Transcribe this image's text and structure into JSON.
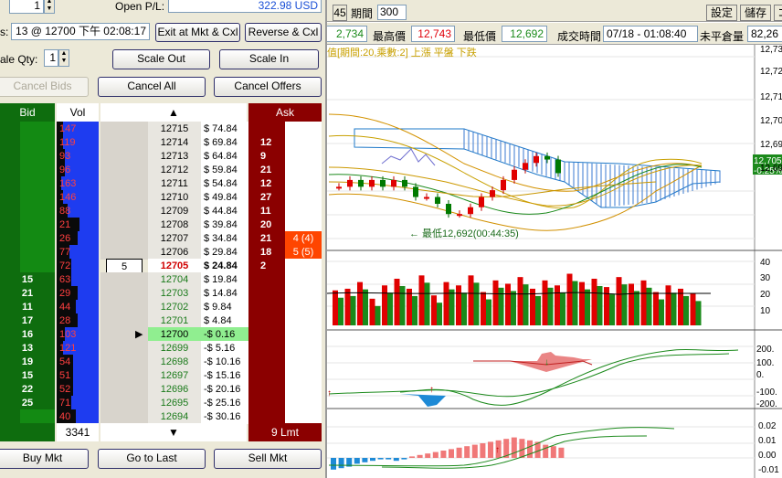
{
  "order_entry": {
    "qty_value": "1",
    "open_pnl_label": "Open P/L:",
    "open_pnl_value": "322.98 USD",
    "position_label_partial": "s:",
    "position_value": "13 @ 12700 下午 02:08:17",
    "exit_button": "Exit at Mkt & Cxl",
    "reverse_button": "Reverse & Cxl",
    "scale_qty_label": "ale Qty:",
    "scale_qty_value": "1",
    "scale_out_button": "Scale Out",
    "scale_in_button": "Scale In",
    "cancel_bids_button": "Cancel Bids",
    "cancel_all_button": "Cancel All",
    "cancel_offers_button": "Cancel Offers"
  },
  "ladder_headers": {
    "bid": "Bid",
    "vol": "Vol",
    "up_arrow": "▲",
    "ask": "Ask"
  },
  "ladder_rows": [
    {
      "bid": "",
      "vol": "147",
      "vol_frac": 0.15,
      "sel": "",
      "price": "12715",
      "pnl": "$ 74.84",
      "ask": "",
      "ord": ""
    },
    {
      "bid": "",
      "vol": "119",
      "vol_frac": 0.15,
      "sel": "",
      "price": "12714",
      "pnl": "$ 69.84",
      "ask": "12",
      "ord": ""
    },
    {
      "bid": "",
      "vol": "93",
      "vol_frac": 0.2,
      "sel": "",
      "price": "12713",
      "pnl": "$ 64.84",
      "ask": "9",
      "ord": ""
    },
    {
      "bid": "",
      "vol": "96",
      "vol_frac": 0.2,
      "sel": "",
      "price": "12712",
      "pnl": "$ 59.84",
      "ask": "21",
      "ord": ""
    },
    {
      "bid": "",
      "vol": "163",
      "vol_frac": 0.1,
      "sel": "",
      "price": "12711",
      "pnl": "$ 54.84",
      "ask": "12",
      "ord": ""
    },
    {
      "bid": "",
      "vol": "146",
      "vol_frac": 0.15,
      "sel": "",
      "price": "12710",
      "pnl": "$ 49.84",
      "ask": "27",
      "ord": ""
    },
    {
      "bid": "",
      "vol": "88",
      "vol_frac": 0.25,
      "sel": "",
      "price": "12709",
      "pnl": "$ 44.84",
      "ask": "11",
      "ord": ""
    },
    {
      "bid": "",
      "vol": "21",
      "vol_frac": 0.55,
      "sel": "",
      "price": "12708",
      "pnl": "$ 39.84",
      "ask": "20",
      "ord": ""
    },
    {
      "bid": "",
      "vol": "26",
      "vol_frac": 0.5,
      "sel": "",
      "price": "12707",
      "pnl": "$ 34.84",
      "ask": "21",
      "ord": "4 (4)"
    },
    {
      "bid": "",
      "vol": "77",
      "vol_frac": 0.3,
      "sel": "",
      "price": "12706",
      "pnl": "$ 29.84",
      "ask": "18",
      "ord": "5 (5)"
    },
    {
      "bid": "",
      "vol": "72",
      "vol_frac": 0.35,
      "sel": "5",
      "price": "12705",
      "pnl": "$ 24.84",
      "ask": "2",
      "ord": "",
      "last": true
    },
    {
      "bid": "15",
      "vol": "63",
      "vol_frac": 0.35,
      "sel": "",
      "price": "12704",
      "pnl": "$ 19.84",
      "ask": "",
      "ord": ""
    },
    {
      "bid": "21",
      "vol": "29",
      "vol_frac": 0.5,
      "sel": "",
      "price": "12703",
      "pnl": "$ 14.84",
      "ask": "",
      "ord": ""
    },
    {
      "bid": "11",
      "vol": "44",
      "vol_frac": 0.45,
      "sel": "",
      "price": "12702",
      "pnl": "$ 9.84",
      "ask": "",
      "ord": ""
    },
    {
      "bid": "17",
      "vol": "28",
      "vol_frac": 0.5,
      "sel": "",
      "price": "12701",
      "pnl": "$ 4.84",
      "ask": "",
      "ord": ""
    },
    {
      "bid": "16",
      "vol": "103",
      "vol_frac": 0.2,
      "sel": "▶",
      "price": "12700",
      "pnl": "-$ 0.16",
      "ask": "",
      "ord": "",
      "entry": true
    },
    {
      "bid": "13",
      "vol": "121",
      "vol_frac": 0.15,
      "sel": "",
      "price": "12699",
      "pnl": "-$ 5.16",
      "ask": "",
      "ord": ""
    },
    {
      "bid": "19",
      "vol": "54",
      "vol_frac": 0.4,
      "sel": "",
      "price": "12698",
      "pnl": "-$ 10.16",
      "ask": "",
      "ord": ""
    },
    {
      "bid": "15",
      "vol": "51",
      "vol_frac": 0.4,
      "sel": "",
      "price": "12697",
      "pnl": "-$ 15.16",
      "ask": "",
      "ord": ""
    },
    {
      "bid": "22",
      "vol": "52",
      "vol_frac": 0.4,
      "sel": "",
      "price": "12696",
      "pnl": "-$ 20.16",
      "ask": "",
      "ord": ""
    },
    {
      "bid": "25",
      "vol": "71",
      "vol_frac": 0.35,
      "sel": "",
      "price": "12695",
      "pnl": "-$ 25.16",
      "ask": "",
      "ord": ""
    },
    {
      "bid": "",
      "vol": "40",
      "vol_frac": 0.45,
      "sel": "",
      "price": "12694",
      "pnl": "-$ 30.16",
      "ask": "",
      "ord": ""
    }
  ],
  "ladder_footer": {
    "vol_total": "3341",
    "down_arrow": "▼",
    "ask_limit": "9 Lmt"
  },
  "bottom_buttons": {
    "buy_mkt": "Buy Mkt",
    "go_to_last": "Go to Last",
    "sell_mkt": "Sell Mkt"
  },
  "chart_toolbar": {
    "period_num": "45",
    "period_label": "期間",
    "period_value": "300",
    "settings_button": "設定",
    "save_button": "儲存",
    "close_partial": "コ",
    "open_partial": "2,734",
    "high_label": "最高價",
    "high_value": "12,743",
    "low_label": "最低價",
    "low_value": "12,692",
    "trade_time_label": "成交時間",
    "trade_time_value": "07/18 - 01:08:40",
    "open_interest_label": "未平倉量",
    "open_interest_value": "82,26"
  },
  "chart_info": {
    "indicator_caption": "值[期間:20,乘數:2] 上漲  平盤  下跌",
    "low_marker": "← 最低12,692(00:44:35)",
    "last_price": "12,705",
    "last_change": "-0.25%"
  },
  "colors": {
    "bid_green": "#0e6d0e",
    "ask_red": "#8b0000",
    "vol_blue": "#1e3cf0",
    "order_orange": "#ff4500",
    "entry_green": "#90ee90"
  },
  "chart_data": [
    {
      "type": "line",
      "title": "",
      "ylabel": "",
      "ylim": [
        12685,
        12740
      ],
      "y_ticks": [
        "12,73",
        "12,72",
        "12,71",
        "12,70",
        "12,69",
        "12,69"
      ],
      "series": [
        {
          "values": [
            12701,
            12703,
            12701,
            12703,
            12701,
            12703,
            12701,
            12698,
            12698,
            12696,
            12693,
            12693,
            12695,
            12698,
            12700,
            12703,
            12706,
            12708,
            12710,
            12709,
            12705
          ]
        }
      ]
    },
    {
      "type": "bar",
      "title": "",
      "ylim": [
        0,
        45
      ],
      "y_ticks": [
        "40",
        "30",
        "20",
        "10"
      ],
      "series": [
        {
          "values": [
            21,
            22,
            26,
            16,
            24,
            28,
            22,
            30,
            18,
            26,
            24,
            30,
            20,
            27,
            25,
            29,
            22,
            27,
            24,
            31,
            26,
            28,
            23,
            29,
            25,
            27,
            20,
            24,
            22,
            19
          ]
        }
      ]
    },
    {
      "type": "area",
      "title": "",
      "ylim": [
        -200,
        200
      ],
      "y_ticks": [
        "200.",
        "100.",
        "0.",
        "-100.",
        "-200."
      ],
      "series": [
        {
          "values": [
            -60,
            -50,
            -40,
            -55,
            -70,
            -110,
            -140,
            -120,
            -80,
            -40,
            -10,
            20,
            60,
            100,
            120,
            130,
            140,
            120,
            110,
            90
          ]
        }
      ]
    },
    {
      "type": "bar",
      "title": "",
      "ylim": [
        -0.02,
        0.025
      ],
      "y_ticks": [
        "0.02",
        "0.01",
        "0.00",
        "-0.01"
      ],
      "series": [
        {
          "values": [
            -0.008,
            -0.007,
            -0.006,
            -0.004,
            -0.003,
            -0.002,
            -0.001,
            -0.001,
            -0.002,
            -0.001,
            0.001,
            0.002,
            0.003,
            0.004,
            0.005,
            0.006,
            0.007,
            0.008,
            0.009,
            0.01,
            0.011,
            0.012,
            0.013,
            0.014,
            0.013,
            0.012,
            0.011,
            0.009,
            0.008,
            0.007
          ]
        }
      ]
    }
  ]
}
